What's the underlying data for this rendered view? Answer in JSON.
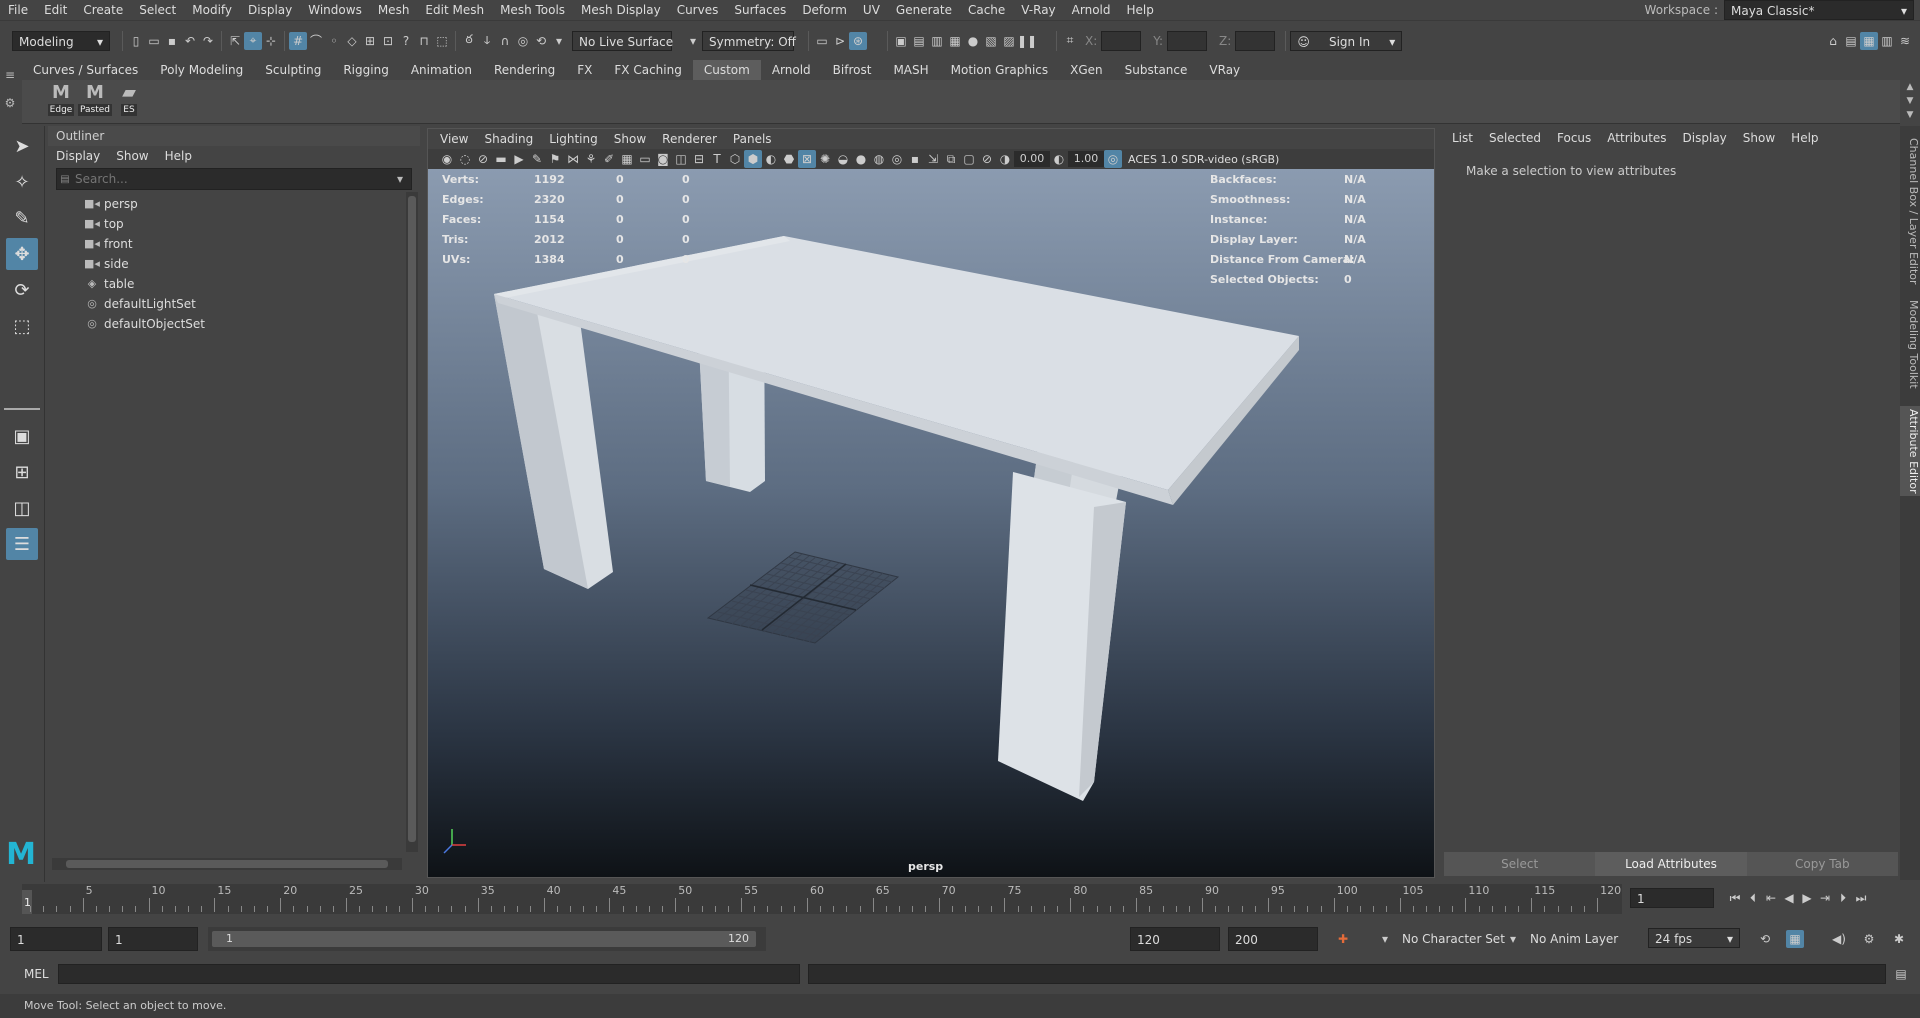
{
  "menubar": {
    "items": [
      "File",
      "Edit",
      "Create",
      "Select",
      "Modify",
      "Display",
      "Windows",
      "Mesh",
      "Edit Mesh",
      "Mesh Tools",
      "Mesh Display",
      "Curves",
      "Surfaces",
      "Deform",
      "UV",
      "Generate",
      "Cache",
      "V-Ray",
      "Arnold",
      "Help"
    ],
    "workspace_label": "Workspace :",
    "workspace_value": "Maya Classic*"
  },
  "statusline": {
    "mode": "Modeling",
    "live_surface": "No Live Surface",
    "symmetry": "Symmetry: Off",
    "x_label": "X:",
    "y_label": "Y:",
    "z_label": "Z:",
    "sign_in": "Sign In"
  },
  "shelf": {
    "tabs": [
      "Curves / Surfaces",
      "Poly Modeling",
      "Sculpting",
      "Rigging",
      "Animation",
      "Rendering",
      "FX",
      "FX Caching",
      "Custom",
      "Arnold",
      "Bifrost",
      "MASH",
      "Motion Graphics",
      "XGen",
      "Substance",
      "VRay"
    ],
    "active_tab": "Custom",
    "buttons": [
      {
        "glyph": "M",
        "label": "Edge"
      },
      {
        "glyph": "M",
        "label": "Pasted"
      },
      {
        "glyph": "▰",
        "label": "ES"
      }
    ]
  },
  "outliner": {
    "title": "Outliner",
    "menu": [
      "Display",
      "Show",
      "Help"
    ],
    "search_placeholder": "Search...",
    "items": [
      {
        "icon": "camera-icon",
        "label": "persp"
      },
      {
        "icon": "camera-icon",
        "label": "top"
      },
      {
        "icon": "camera-icon",
        "label": "front"
      },
      {
        "icon": "camera-icon",
        "label": "side"
      },
      {
        "icon": "mesh-icon",
        "label": "table"
      },
      {
        "icon": "set-icon",
        "label": "defaultLightSet"
      },
      {
        "icon": "set-icon",
        "label": "defaultObjectSet"
      }
    ]
  },
  "viewport": {
    "menu": [
      "View",
      "Shading",
      "Lighting",
      "Show",
      "Renderer",
      "Panels"
    ],
    "near_value": "0.00",
    "far_value": "1.00",
    "colorspace": "ACES 1.0 SDR-video (sRGB)",
    "camera_name": "persp",
    "hud_left": [
      {
        "label": "Verts:",
        "a": "1192",
        "b": "0",
        "c": "0"
      },
      {
        "label": "Edges:",
        "a": "2320",
        "b": "0",
        "c": "0"
      },
      {
        "label": "Faces:",
        "a": "1154",
        "b": "0",
        "c": "0"
      },
      {
        "label": "Tris:",
        "a": "2012",
        "b": "0",
        "c": "0"
      },
      {
        "label": "UVs:",
        "a": "1384",
        "b": "0",
        "c": "0"
      }
    ],
    "hud_right": [
      {
        "label": "Backfaces:",
        "value": "N/A"
      },
      {
        "label": "Smoothness:",
        "value": "N/A"
      },
      {
        "label": "Instance:",
        "value": "N/A"
      },
      {
        "label": "Display Layer:",
        "value": "N/A"
      },
      {
        "label": "Distance From Camera:",
        "value": "N/A"
      },
      {
        "label": "Selected Objects:",
        "value": "0"
      }
    ]
  },
  "attribute_editor": {
    "menu": [
      "List",
      "Selected",
      "Focus",
      "Attributes",
      "Display",
      "Show",
      "Help"
    ],
    "message": "Make a selection to view attributes",
    "buttons": [
      "Select",
      "Load Attributes",
      "Copy Tab"
    ]
  },
  "side_tabs": [
    "Channel Box / Layer Editor",
    "Modeling Toolkit",
    "Attribute Editor"
  ],
  "timeslider": {
    "ticks": [
      "5",
      "10",
      "15",
      "20",
      "25",
      "30",
      "35",
      "40",
      "45",
      "50",
      "55",
      "60",
      "65",
      "70",
      "75",
      "80",
      "85",
      "90",
      "95",
      "100",
      "105",
      "110",
      "115",
      "120"
    ],
    "start_marker": "1",
    "current_frame": "1"
  },
  "range": {
    "start": "1",
    "playback_start": "1",
    "slider_start": "1",
    "slider_end": "120",
    "playback_end": "120",
    "end": "200",
    "character_set": "No Character Set",
    "anim_layer": "No Anim Layer",
    "fps": "24 fps"
  },
  "cmdline": {
    "language": "MEL"
  },
  "helpline": {
    "text": "Move Tool: Select an object to move."
  }
}
